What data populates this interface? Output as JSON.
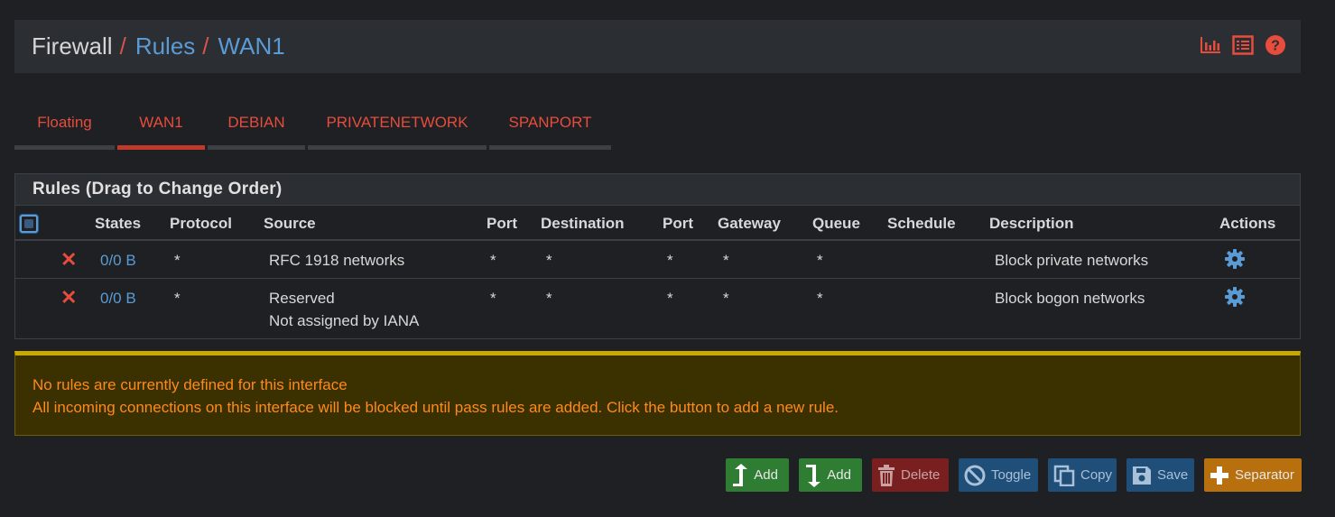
{
  "breadcrumb": {
    "part1": "Firewall",
    "part2": "Rules",
    "part3": "WAN1",
    "separator": "/"
  },
  "header_icons": [
    "chart-icon",
    "list-icon",
    "help-icon"
  ],
  "tabs": [
    {
      "label": "Floating",
      "active": false
    },
    {
      "label": "WAN1",
      "active": true
    },
    {
      "label": "DEBIAN",
      "active": false
    },
    {
      "label": "PRIVATENETWORK",
      "active": false
    },
    {
      "label": "SPANPORT",
      "active": false
    }
  ],
  "panel": {
    "title": "Rules (Drag to Change Order)",
    "columns": [
      "States",
      "Protocol",
      "Source",
      "Port",
      "Destination",
      "Port",
      "Gateway",
      "Queue",
      "Schedule",
      "Description",
      "Actions"
    ],
    "rows": [
      {
        "states": "0/0 B",
        "protocol": "*",
        "source": "RFC 1918 networks",
        "source2": "",
        "port": "*",
        "destination": "*",
        "dport": "*",
        "gateway": "*",
        "queue": "*",
        "schedule": "",
        "description": "Block private networks"
      },
      {
        "states": "0/0 B",
        "protocol": "*",
        "source": "Reserved",
        "source2": "Not assigned by IANA",
        "port": "*",
        "destination": "*",
        "dport": "*",
        "gateway": "*",
        "queue": "*",
        "schedule": "",
        "description": "Block bogon networks"
      }
    ]
  },
  "alert": {
    "line1": "No rules are currently defined for this interface",
    "line2": "All incoming connections on this interface will be blocked until pass rules are added. Click the button to add a new rule."
  },
  "buttons": {
    "add_top": "Add",
    "add_bottom": "Add",
    "delete": "Delete",
    "toggle": "Toggle",
    "copy": "Copy",
    "save": "Save",
    "separator": "Separator"
  },
  "colors": {
    "accent_red": "#e74c3c",
    "link_blue": "#5b9bd5",
    "warning_text": "#ff8a1c"
  }
}
